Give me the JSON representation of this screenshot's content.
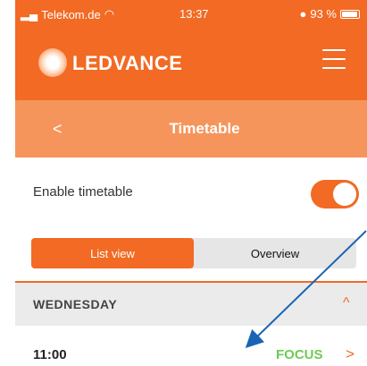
{
  "status_bar": {
    "carrier": "Telekom.de",
    "time": "13:37",
    "battery": "93 %"
  },
  "header": {
    "brand": "LEDVANCE"
  },
  "subheader": {
    "back": "<",
    "title": "Timetable"
  },
  "enable_timetable": {
    "label": "Enable timetable",
    "enabled": true
  },
  "view_tabs": [
    {
      "label": "List view",
      "active": true
    },
    {
      "label": "Overview",
      "active": false
    }
  ],
  "day_section": {
    "label": "WEDNESDAY",
    "expanded": true
  },
  "entry": {
    "time": "11:00",
    "mode": "FOCUS"
  },
  "colors": {
    "accent": "#f26a23",
    "accent_light": "#f5955b",
    "mode_green": "#6ccb53",
    "annotation_blue": "#1a64b4"
  }
}
